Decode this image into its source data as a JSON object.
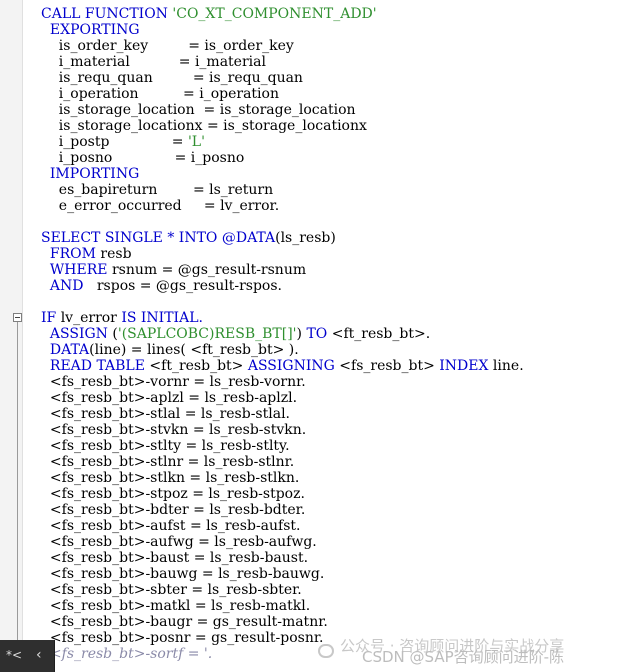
{
  "editor": {
    "lines": [
      [
        {
          "t": "CALL FUNCTION ",
          "c": "kw"
        },
        {
          "t": "'CO_XT_COMPONENT_ADD'",
          "c": "str"
        }
      ],
      [
        {
          "t": "  "
        },
        {
          "t": "EXPORTING",
          "c": "kw"
        }
      ],
      [
        {
          "t": "    is_order_key         = is_order_key"
        }
      ],
      [
        {
          "t": "    i_material           = i_material"
        }
      ],
      [
        {
          "t": "    is_requ_quan         = is_requ_quan"
        }
      ],
      [
        {
          "t": "    i_operation          = i_operation"
        }
      ],
      [
        {
          "t": "    is_storage_location  = is_storage_location"
        }
      ],
      [
        {
          "t": "    is_storage_locationx = is_storage_locationx"
        }
      ],
      [
        {
          "t": "    i_postp              = "
        },
        {
          "t": "'L'",
          "c": "str"
        }
      ],
      [
        {
          "t": "    i_posno              = i_posno"
        }
      ],
      [
        {
          "t": "  "
        },
        {
          "t": "IMPORTING",
          "c": "kw"
        }
      ],
      [
        {
          "t": "    es_bapireturn        = ls_return"
        }
      ],
      [
        {
          "t": "    e_error_occurred     = lv_error."
        }
      ],
      [
        {
          "t": ""
        }
      ],
      [
        {
          "t": "SELECT SINGLE * INTO @DATA",
          "c": "kw"
        },
        {
          "t": "(ls_resb)"
        }
      ],
      [
        {
          "t": "  "
        },
        {
          "t": "FROM",
          "c": "kw"
        },
        {
          "t": " resb"
        }
      ],
      [
        {
          "t": "  "
        },
        {
          "t": "WHERE",
          "c": "kw"
        },
        {
          "t": " rsnum = @gs_result-rsnum"
        }
      ],
      [
        {
          "t": "  "
        },
        {
          "t": "AND",
          "c": "kw"
        },
        {
          "t": "   rspos = @gs_result-rspos."
        }
      ],
      [
        {
          "t": ""
        }
      ],
      [
        {
          "t": "IF",
          "c": "kw"
        },
        {
          "t": " lv_error "
        },
        {
          "t": "IS INITIAL.",
          "c": "kw"
        }
      ],
      [
        {
          "t": "  "
        },
        {
          "t": "ASSIGN",
          "c": "kw"
        },
        {
          "t": " ("
        },
        {
          "t": "'(SAPLCOBC)RESB_BT[]'",
          "c": "str"
        },
        {
          "t": ") "
        },
        {
          "t": "TO",
          "c": "kw"
        },
        {
          "t": " <ft_resb_bt>."
        }
      ],
      [
        {
          "t": "  "
        },
        {
          "t": "DATA",
          "c": "kw"
        },
        {
          "t": "(line) = lines( <ft_resb_bt> )."
        }
      ],
      [
        {
          "t": "  "
        },
        {
          "t": "READ TABLE",
          "c": "kw"
        },
        {
          "t": " <ft_resb_bt> "
        },
        {
          "t": "ASSIGNING",
          "c": "kw"
        },
        {
          "t": " <fs_resb_bt> "
        },
        {
          "t": "INDEX",
          "c": "kw"
        },
        {
          "t": " line."
        }
      ],
      [
        {
          "t": "  <fs_resb_bt>-vornr = ls_resb-vornr."
        }
      ],
      [
        {
          "t": "  <fs_resb_bt>-aplzl = ls_resb-aplzl."
        }
      ],
      [
        {
          "t": "  <fs_resb_bt>-stlal = ls_resb-stlal."
        }
      ],
      [
        {
          "t": "  <fs_resb_bt>-stvkn = ls_resb-stvkn."
        }
      ],
      [
        {
          "t": "  <fs_resb_bt>-stlty = ls_resb-stlty."
        }
      ],
      [
        {
          "t": "  <fs_resb_bt>-stlnr = ls_resb-stlnr."
        }
      ],
      [
        {
          "t": "  <fs_resb_bt>-stlkn = ls_resb-stlkn."
        }
      ],
      [
        {
          "t": "  <fs_resb_bt>-stpoz = ls_resb-stpoz."
        }
      ],
      [
        {
          "t": "  <fs_resb_bt>-bdter = ls_resb-bdter."
        }
      ],
      [
        {
          "t": "  <fs_resb_bt>-aufst = ls_resb-aufst."
        }
      ],
      [
        {
          "t": "  <fs_resb_bt>-aufwg = ls_resb-aufwg."
        }
      ],
      [
        {
          "t": "  <fs_resb_bt>-baust = ls_resb-baust."
        }
      ],
      [
        {
          "t": "  <fs_resb_bt>-bauwg = ls_resb-bauwg."
        }
      ],
      [
        {
          "t": "  <fs_resb_bt>-sbter = ls_resb-sbter."
        }
      ],
      [
        {
          "t": "  <fs_resb_bt>-matkl = ls_resb-matkl."
        }
      ],
      [
        {
          "t": "  <fs_resb_bt>-baugr = gs_result-matnr."
        }
      ],
      [
        {
          "t": "  <fs_resb_bt>-posnr = gs_result-posnr."
        }
      ],
      [
        {
          "t": "  <fs_resb_bt>-sortf = '.",
          "c": "faded"
        }
      ]
    ]
  },
  "bottom_bar": {
    "star": "*<",
    "chevron": "‹"
  },
  "watermark": {
    "account": "公众号 · 咨询顾问进阶与实战分享",
    "brand": "CSDN @SAP咨询顾问进阶-陈"
  },
  "colors": {
    "keyword": "#0000cd",
    "string": "#2f8f2f",
    "text": "#000000"
  }
}
